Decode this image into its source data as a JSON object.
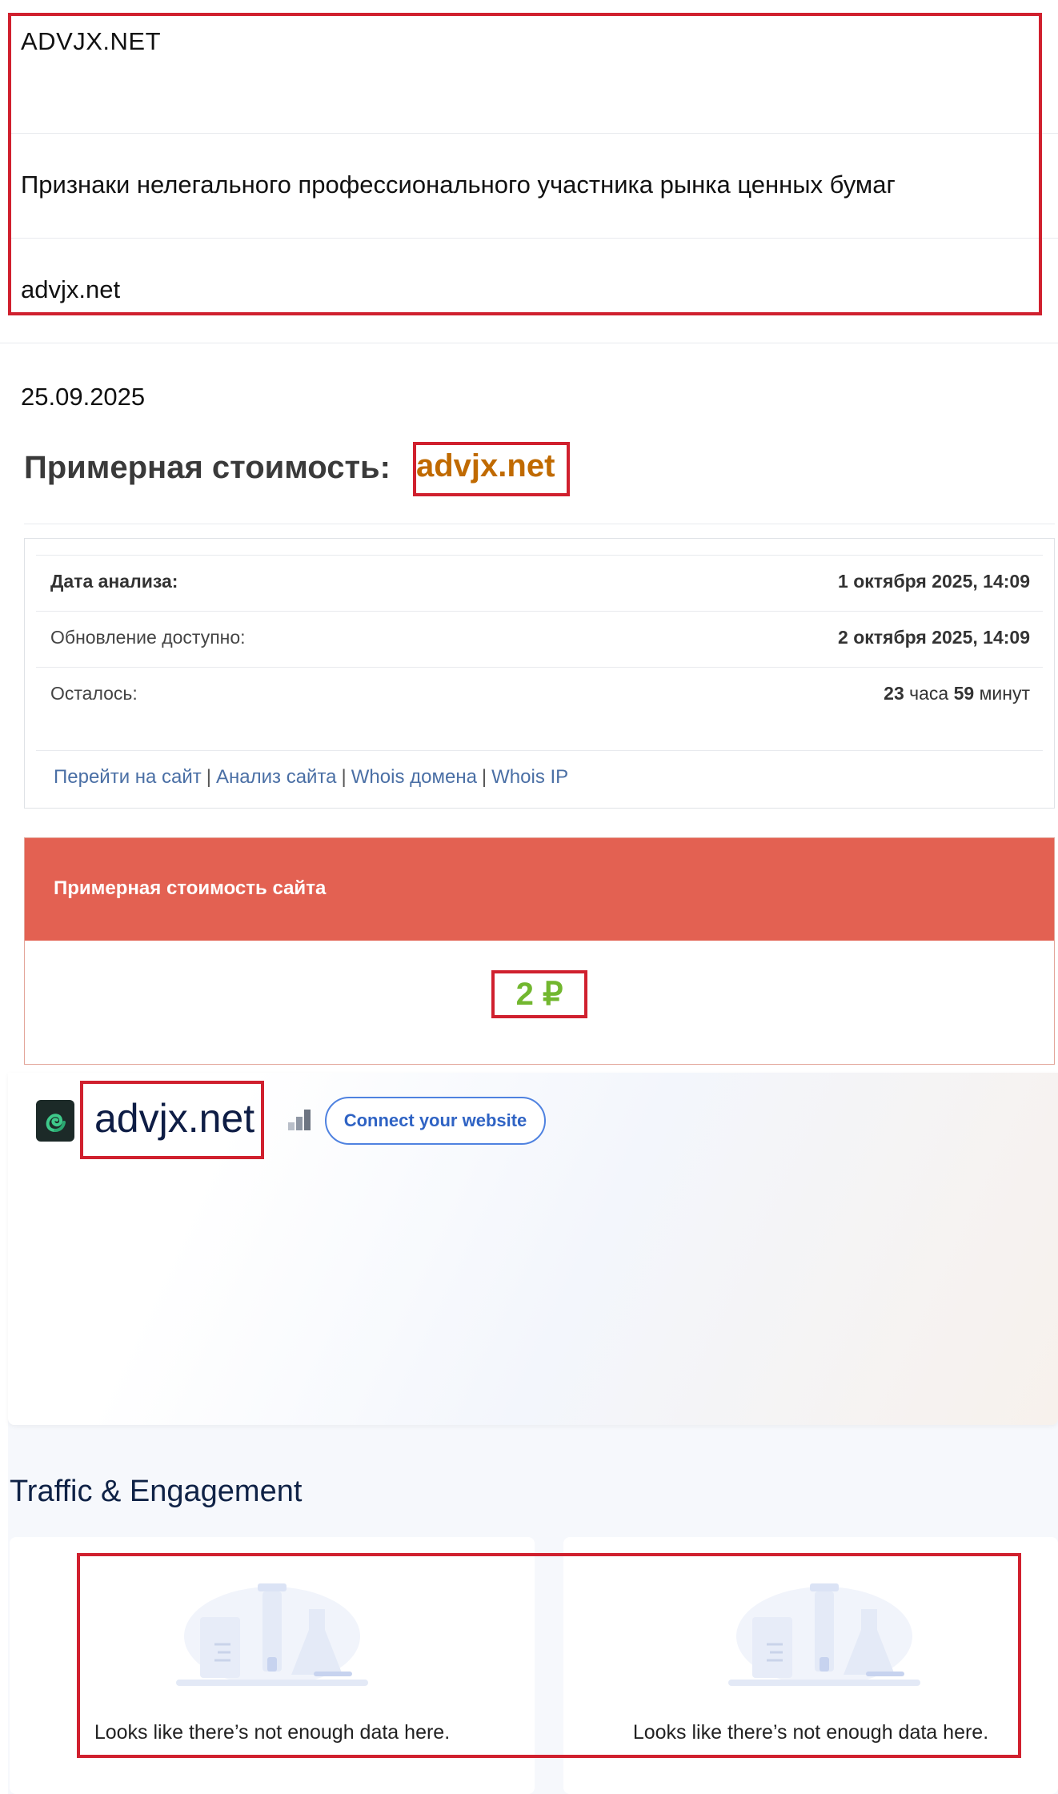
{
  "top_card": {
    "brand": "ADVJX.NET",
    "description": "Признаки нелегального профессионального участника рынка ценных бумаг",
    "domain": "advjx.net"
  },
  "estimate": {
    "date": "25.09.2025",
    "title": "Примерная стоимость:",
    "domain": "advjx.net",
    "info": {
      "analysis_label": "Дата анализа:",
      "analysis_value": "1 октября 2025, 14:09",
      "update_label": "Обновление доступно:",
      "update_value": "2 октября 2025, 14:09",
      "remaining_label": "Осталось:",
      "remaining_value_hours": "23",
      "remaining_hours_word": "часа",
      "remaining_value_minutes": "59",
      "remaining_minutes_word": "минут"
    },
    "links": [
      "Перейти на сайт",
      "Анализ сайта",
      "Whois домена",
      "Whois IP"
    ],
    "link_separator": "|",
    "cost_header": "Примерная стоимость сайта",
    "cost_value": "2 ₽"
  },
  "similarweb": {
    "domain": "advjx.net",
    "connect_button": "Connect your website",
    "section_title": "Traffic & Engagement",
    "panels": [
      {
        "message": "Looks like there’s not enough data here."
      },
      {
        "message": "Looks like there’s not enough data here."
      }
    ]
  },
  "colors": {
    "highlight_border": "#d0202e",
    "cost_header_bg": "#e36152",
    "cost_value": "#72b72f",
    "title_domain": "#c06a00",
    "link": "#4a6fa5"
  },
  "icons": [
    "site-logo-icon",
    "rank-bars-icon",
    "empty-data-illustration"
  ]
}
